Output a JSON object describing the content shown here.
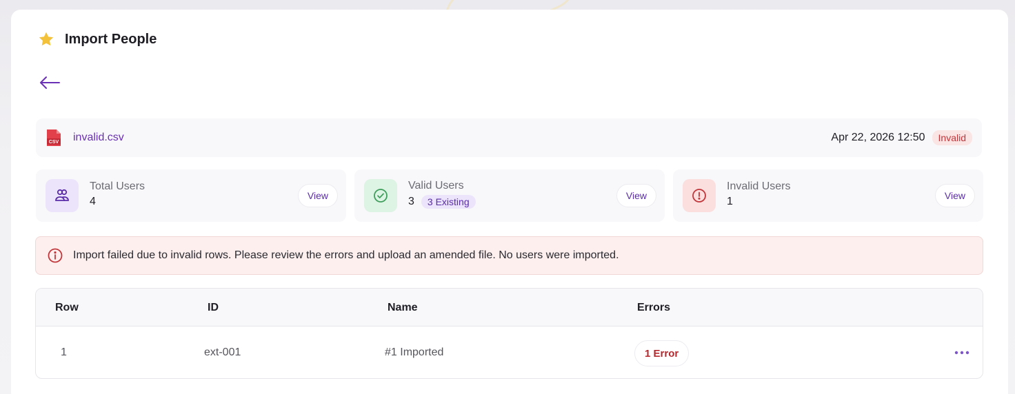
{
  "header": {
    "title": "Import People",
    "icon": "star-icon",
    "accent": "#f3c13a"
  },
  "file": {
    "name": "invalid.csv",
    "icon_text": "CSV",
    "date": "Apr 22, 2026 12:50",
    "status": "Invalid"
  },
  "stats": [
    {
      "label": "Total Users",
      "value": "4",
      "button": "View",
      "icon": "users-icon"
    },
    {
      "label": "Valid Users",
      "value": "3",
      "extra": "3 Existing",
      "button": "View",
      "icon": "check-circle-icon"
    },
    {
      "label": "Invalid Users",
      "value": "1",
      "button": "View",
      "icon": "alert-circle-icon"
    }
  ],
  "alert": {
    "message": "Import failed due to invalid rows. Please review the errors and upload an amended file. No users were imported."
  },
  "table": {
    "columns": [
      "Row",
      "ID",
      "Name",
      "Errors"
    ],
    "rows": [
      {
        "row": "1",
        "id": "ext-001",
        "name": "#1 Imported",
        "errors": "1 Error"
      }
    ]
  },
  "colors": {
    "brand": "#6a30b5",
    "danger": "#c0363a",
    "success": "#3f9e5c"
  }
}
